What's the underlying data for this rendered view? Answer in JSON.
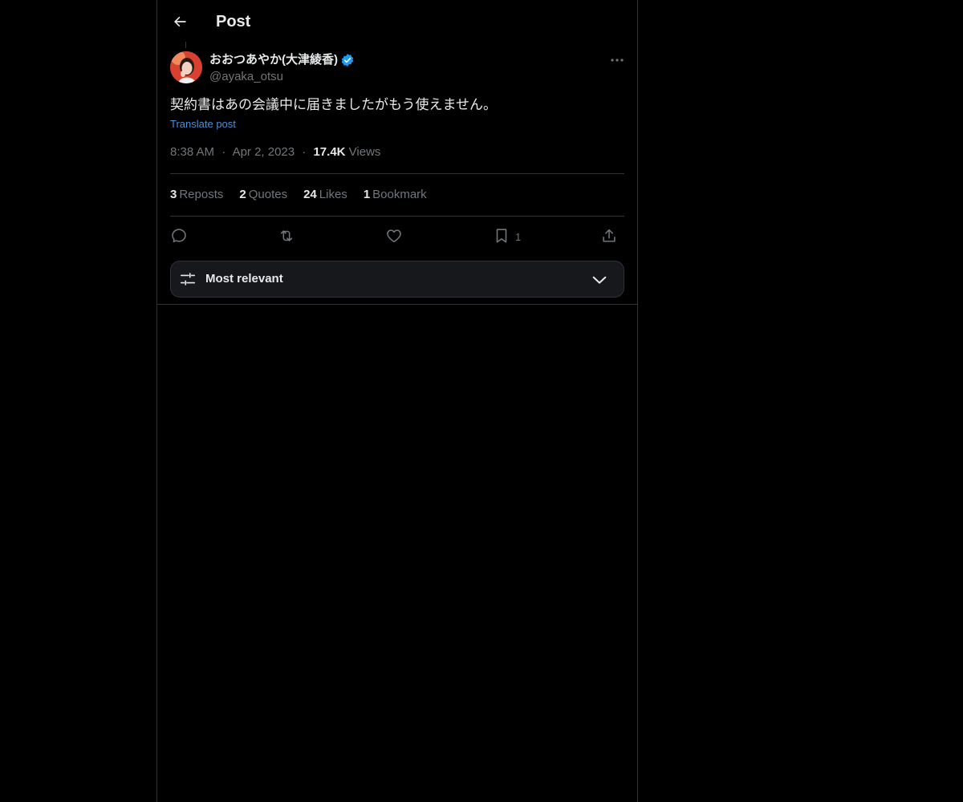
{
  "header": {
    "back_icon": "arrow-left-icon",
    "title": "Post"
  },
  "post": {
    "author": {
      "name": "おおつあやか(大津綾香)",
      "handle": "@ayaka_otsu",
      "verified_icon": "verified-badge-icon",
      "verified_color": "#1d9bf0"
    },
    "more_icon": "more-horizontal-icon",
    "text": "契約書はあの会議中に届きましたがもう使えません。",
    "translate_label": "Translate post",
    "time": "8:38 AM",
    "separator": "·",
    "date": "Apr 2, 2023",
    "views_count": "17.4K",
    "views_label": "Views"
  },
  "stats": {
    "reposts_count": "3",
    "reposts_label": "Reposts",
    "quotes_count": "2",
    "quotes_label": "Quotes",
    "likes_count": "24",
    "likes_label": "Likes",
    "bookmarks_count": "1",
    "bookmarks_label": "Bookmark"
  },
  "actions": {
    "reply_icon": "reply-icon",
    "repost_icon": "repost-icon",
    "like_icon": "heart-icon",
    "bookmark_icon": "bookmark-icon",
    "bookmark_count": "1",
    "share_icon": "share-icon"
  },
  "sort": {
    "icon": "sliders-icon",
    "label": "Most relevant",
    "chevron_icon": "chevron-down-icon"
  },
  "colors": {
    "background": "#000000",
    "text_primary": "#e7e9ea",
    "text_secondary": "#71767b",
    "link": "#4d8fd6",
    "border": "#2f3336"
  }
}
